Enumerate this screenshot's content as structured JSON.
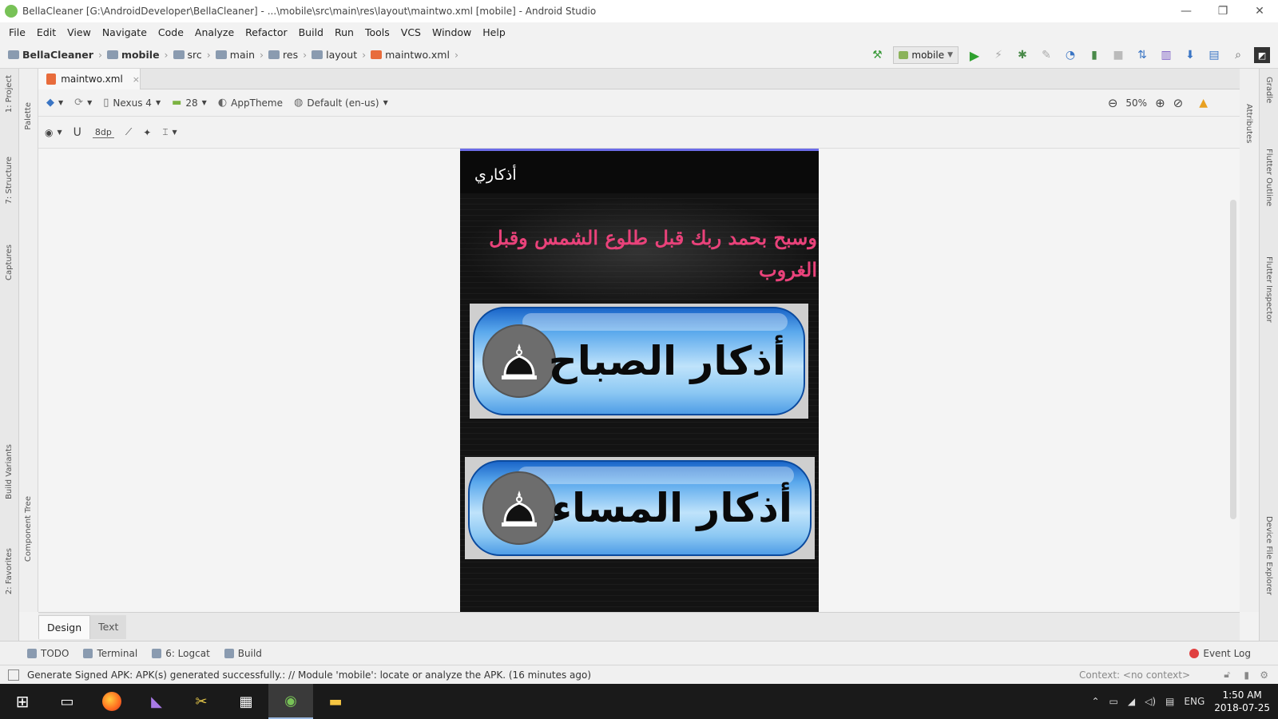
{
  "window": {
    "title": "BellaCleaner [G:\\AndroidDeveloper\\BellaCleaner] - ...\\mobile\\src\\main\\res\\layout\\maintwo.xml [mobile] - Android Studio",
    "minimize": "—",
    "maximize": "❐",
    "close": "✕"
  },
  "menu": [
    "File",
    "Edit",
    "View",
    "Navigate",
    "Code",
    "Analyze",
    "Refactor",
    "Build",
    "Run",
    "Tools",
    "VCS",
    "Window",
    "Help"
  ],
  "breadcrumb": [
    "BellaCleaner",
    "mobile",
    "src",
    "main",
    "res",
    "layout",
    "maintwo.xml"
  ],
  "toolbar": {
    "config": "mobile"
  },
  "editor_tab": {
    "label": "maintwo.xml",
    "close": "×"
  },
  "design_toolbar": {
    "device": "Nexus 4",
    "api": "28",
    "theme": "AppTheme",
    "locale": "Default (en-us)",
    "zoom": "50%"
  },
  "phone": {
    "app_title": "أذكاري",
    "verse": "وسبح بحمد ربك قبل طلوع الشمس وقبل الغروب",
    "buttons": [
      {
        "label": "أذكار الصباح"
      },
      {
        "label": "أذكار المساء"
      }
    ]
  },
  "left_panels": [
    "1: Project",
    "Palette",
    "7: Structure",
    "Captures",
    "Build Variants",
    "Component Tree",
    "2: Favorites"
  ],
  "right_panels": [
    "Gradle",
    "Attributes",
    "Flutter Outline",
    "Flutter Inspector",
    "Device File Explorer"
  ],
  "editor_mode_tabs": {
    "design": "Design",
    "text": "Text"
  },
  "tool_windows": [
    "TODO",
    "Terminal",
    "6: Logcat",
    "Build"
  ],
  "event_log": "Event Log",
  "status": {
    "message": "Generate Signed APK: APK(s) generated successfully.: // Module 'mobile': locate or analyze the APK. (16 minutes ago)",
    "context": "Context: <no context>"
  },
  "taskbar": {
    "lang": "ENG",
    "time": "1:50 AM",
    "date": "2018-07-25"
  }
}
